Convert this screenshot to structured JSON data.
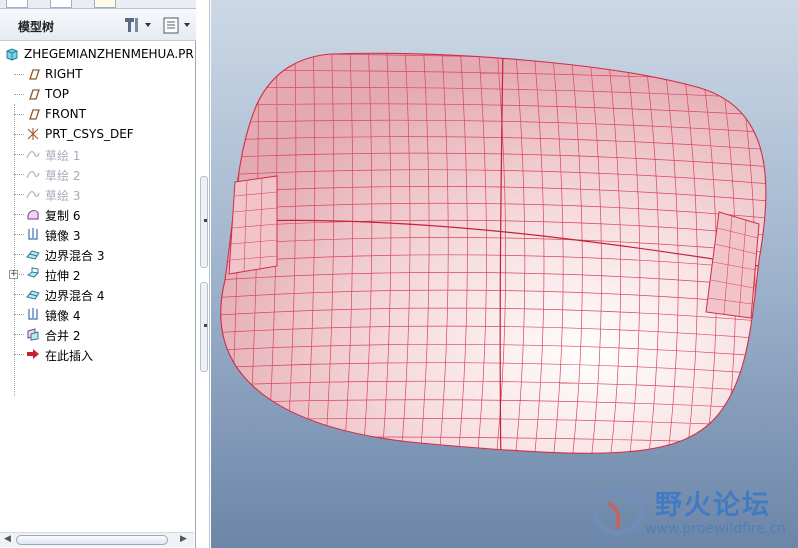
{
  "panel": {
    "title": "模型树",
    "root": "ZHEGEMIANZHENMEHUA.PR",
    "items": [
      {
        "label": "RIGHT",
        "icon": "datum-plane-icon",
        "state": "normal"
      },
      {
        "label": "TOP",
        "icon": "datum-plane-icon",
        "state": "normal"
      },
      {
        "label": "FRONT",
        "icon": "datum-plane-icon",
        "state": "normal"
      },
      {
        "label": "PRT_CSYS_DEF",
        "icon": "csys-icon",
        "state": "normal"
      },
      {
        "label": "草绘 1",
        "icon": "sketch-icon",
        "state": "hidden"
      },
      {
        "label": "草绘 2",
        "icon": "sketch-icon",
        "state": "hidden"
      },
      {
        "label": "草绘 3",
        "icon": "sketch-icon",
        "state": "hidden"
      },
      {
        "label": "复制 6",
        "icon": "copy-surface-icon",
        "state": "normal"
      },
      {
        "label": "镜像 3",
        "icon": "mirror-icon",
        "state": "normal"
      },
      {
        "label": "边界混合 3",
        "icon": "boundary-blend-icon",
        "state": "normal"
      },
      {
        "label": "拉伸 2",
        "icon": "extrude-icon",
        "state": "normal",
        "expander": "+"
      },
      {
        "label": "边界混合 4",
        "icon": "boundary-blend-icon",
        "state": "normal"
      },
      {
        "label": "镜像 4",
        "icon": "mirror-icon",
        "state": "normal"
      },
      {
        "label": "合并 2",
        "icon": "merge-icon",
        "state": "normal"
      },
      {
        "label": "在此插入",
        "icon": "insert-arrow-icon",
        "state": "normal"
      }
    ]
  },
  "watermark": {
    "title": "野火论坛",
    "url": "www.proewildfire.cn"
  },
  "colors": {
    "surface_fill": "#f2cfd4",
    "mesh_line": "#d9465a",
    "viewport_top": "#ccd8e6",
    "viewport_bottom": "#6c86a8"
  }
}
